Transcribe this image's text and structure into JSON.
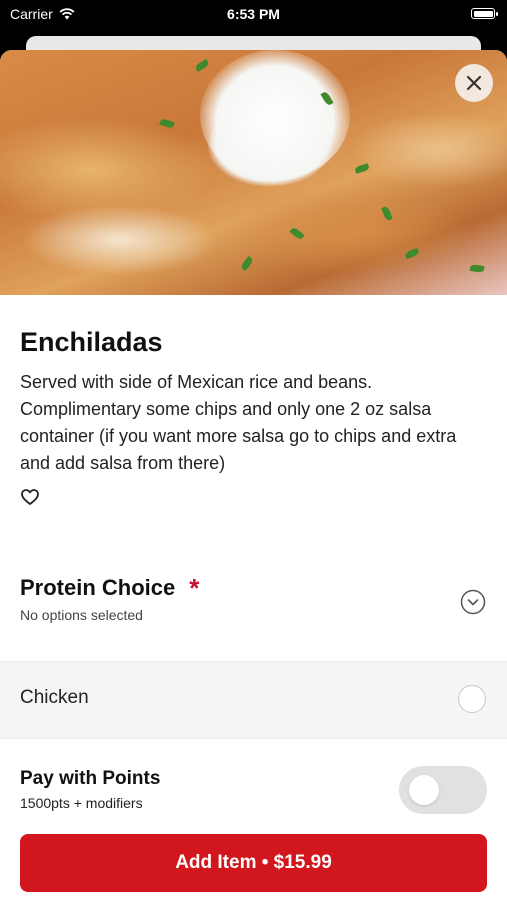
{
  "status_bar": {
    "carrier": "Carrier",
    "time": "6:53 PM"
  },
  "item": {
    "title": "Enchiladas",
    "description": "Served with side of Mexican rice and beans. Complimentary some chips and only one 2 oz salsa container (if you want more salsa go to chips and extra and add salsa from there)"
  },
  "protein": {
    "title": "Protein Choice",
    "required_marker": "*",
    "subtitle": "No options selected",
    "options": [
      {
        "label": "Chicken",
        "selected": false
      }
    ]
  },
  "points": {
    "title": "Pay with Points",
    "subtitle": "1500pts + modifiers",
    "enabled": false
  },
  "cta": {
    "label": "Add Item • $15.99"
  },
  "colors": {
    "accent": "#d2161e",
    "required": "#c8102e",
    "toggle_off": "#e1e1e1"
  },
  "icons": [
    "wifi-icon",
    "battery-icon",
    "close-icon",
    "heart-icon",
    "chevron-down-circle-icon",
    "radio-icon"
  ]
}
